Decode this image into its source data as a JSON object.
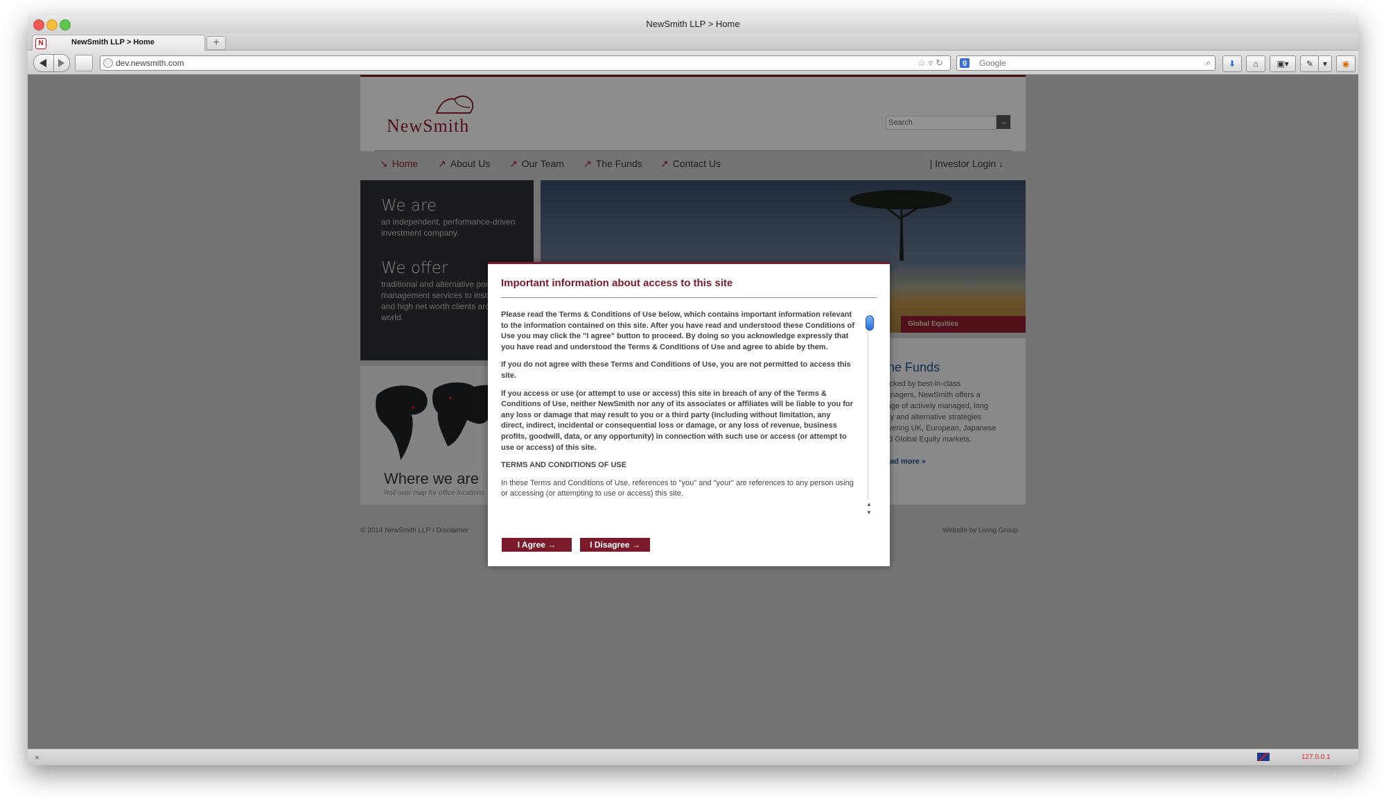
{
  "window": {
    "title": "NewSmith LLP > Home",
    "tab_title": "NewSmith LLP > Home",
    "new_tab": "+"
  },
  "toolbar": {
    "url": "dev.newsmith.com",
    "search_placeholder": "Google",
    "search_engine_icon": "google-g-icon"
  },
  "site": {
    "logo": "NewSmith",
    "search_placeholder": "Search",
    "search_go": "→",
    "nav": [
      {
        "label": "Home",
        "arrow": "↘"
      },
      {
        "label": "About Us",
        "arrow": "↗"
      },
      {
        "label": "Our Team",
        "arrow": "↗"
      },
      {
        "label": "The Funds",
        "arrow": "↗"
      },
      {
        "label": "Contact Us",
        "arrow": "↗"
      }
    ],
    "investor_login": "Investor Login",
    "investor_arrow": "↓",
    "we_are_head": "We are",
    "we_are_body": "an independent, performance-driven investment company.",
    "we_offer_head": "We offer",
    "we_offer_body": "traditional and alternative portfolio management services to institutional and high net worth clients around the world.",
    "hero_ribbon": "Global Equities",
    "map_title": "Where we are",
    "map_hint": "Roll over map for office locations",
    "funds_title": "The Funds",
    "funds_body": "Backed by best-in-class managers, NewSmith offers a range of actively managed, long only and alternative strategies covering UK, European, Japanese and Global Equity markets.",
    "funds_more": "Read more »",
    "footer_left": "© 2014 NewSmith LLP  /  Disclaimer",
    "footer_right": "Website by Living Group"
  },
  "modal": {
    "title": "Important information about access to this site",
    "paragraphs": [
      "Please read the Terms & Conditions of Use below, which contains important information relevant to the information contained on this site. After you have read and understood these Conditions of Use you may click the \"I agree\" button to proceed. By doing so you acknowledge expressly that you have read and understood the Terms & Conditions of Use and agree to abide by them.",
      "If you do not agree with these Terms and Conditions of Use, you are not permitted to access this site.",
      "If you access or use (or attempt to use or access) this site in breach of any of the Terms & Conditions of Use, neither NewSmith nor any of its associates or affiliates will be liable to you for any loss or damage that may result to you or a third party (including without limitation, any direct, indirect, incidental or consequential loss or damage, or any loss of revenue, business profits, goodwill, data, or any opportunity) in connection with such use or access (or attempt to use or access) of this site.",
      "TERMS AND CONDITIONS OF USE",
      "In these Terms and Conditions of Use, references to \"you\" and \"your\" are references to any person using or accessing (or attempting to use or access) this site."
    ],
    "agree_label": "I Agree  →",
    "disagree_label": "I Disagree  →"
  },
  "statusbar": {
    "close": "×",
    "ip": "127.0.0.1"
  },
  "colors": {
    "brand": "#7a1a2a",
    "link": "#1d4f8a"
  }
}
